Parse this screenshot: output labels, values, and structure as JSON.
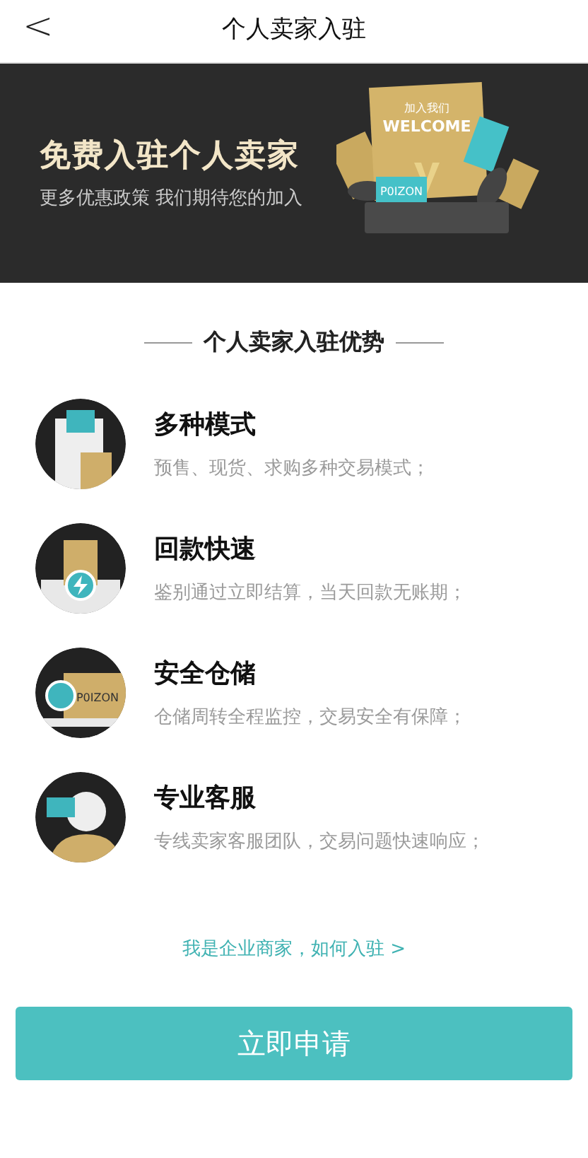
{
  "header": {
    "back": "<",
    "title": "个人卖家入驻"
  },
  "banner": {
    "title": "免费入驻个人卖家",
    "subtitle": "更多优惠政策 我们期待您的加入",
    "art": {
      "card_caption": "加入我们",
      "card_title": "WELCOME",
      "tag": "P0IZON"
    }
  },
  "section_title": "个人卖家入驻优势",
  "features": [
    {
      "kind": "modes",
      "title": "多种模式",
      "description": "预售、现货、求购多种交易模式；"
    },
    {
      "kind": "payment",
      "title": "回款快速",
      "description": "鉴别通过立即结算，当天回款无账期；"
    },
    {
      "kind": "storage",
      "title": "安全仓储",
      "description": "仓储周转全程监控，交易安全有保障；",
      "tag": "P0IZON"
    },
    {
      "kind": "service",
      "title": "专业客服",
      "description": "专线卖家客服团队，交易问题快速响应；"
    }
  ],
  "enterprise_link": "我是企业商家，如何入驻 >",
  "apply_button": "立即申请"
}
